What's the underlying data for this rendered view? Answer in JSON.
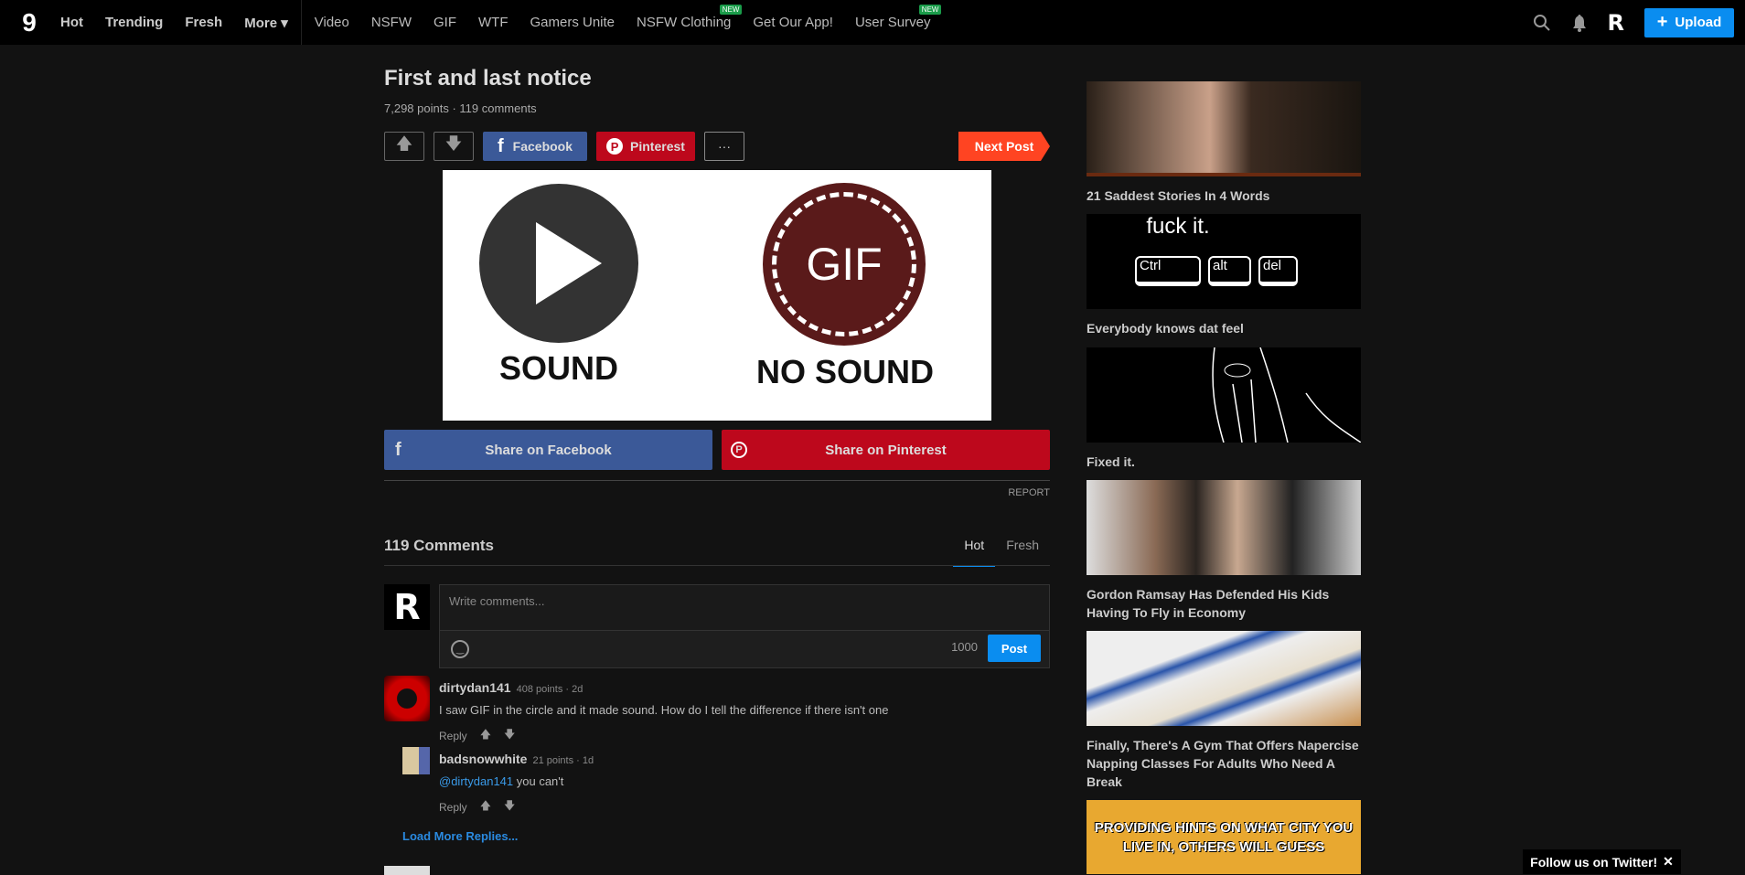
{
  "header": {
    "logo": "9",
    "nav": [
      {
        "label": "Hot",
        "bold": true
      },
      {
        "label": "Trending",
        "bold": true
      },
      {
        "label": "Fresh",
        "bold": true
      },
      {
        "label": "More ▾",
        "bold": true
      },
      {
        "label": "Video"
      },
      {
        "label": "NSFW"
      },
      {
        "label": "GIF"
      },
      {
        "label": "WTF"
      },
      {
        "label": "Gamers Unite"
      },
      {
        "label": "NSFW Clothing",
        "badge": "NEW"
      },
      {
        "label": "Get Our App!"
      },
      {
        "label": "User Survey",
        "badge": "NEW"
      }
    ],
    "avatar": "R",
    "upload_label": "Upload"
  },
  "post": {
    "title": "First and last notice",
    "meta": "7,298 points · 119 comments",
    "facebook": "Facebook",
    "pinterest": "Pinterest",
    "more": "···",
    "next": "Next Post",
    "image": {
      "left_label": "SOUND",
      "right_label": "NO SOUND",
      "gif": "GIF"
    },
    "share_fb": "Share on Facebook",
    "share_pin": "Share on Pinterest",
    "report": "REPORT"
  },
  "comments": {
    "heading": "119 Comments",
    "tabs": [
      "Hot",
      "Fresh"
    ],
    "placeholder": "Write comments...",
    "counter": "1000",
    "post_label": "Post",
    "user_avatar": "R",
    "reply": "Reply",
    "items": [
      {
        "user": "dirtydan141",
        "meta": "408 points · 2d",
        "text": "I saw GIF in the circle and it made sound. How do I tell the difference if there isn't one"
      },
      {
        "user": "badsnowwhite",
        "meta": "21 points · 1d",
        "mention": "@dirtydan141",
        "text": " you can't"
      }
    ],
    "load_more": "Load More Replies..."
  },
  "sidebar": [
    {
      "caption": "21 Saddest Stories In 4 Words"
    },
    {
      "caption": "Everybody knows dat feel",
      "img_text": "fuck it.",
      "keys": [
        "Ctrl",
        "alt",
        "del"
      ]
    },
    {
      "caption": "Fixed it."
    },
    {
      "caption": "Gordon Ramsay Has Defended His Kids Having To Fly in Economy"
    },
    {
      "caption": "Finally, There's A Gym That Offers Napercise Napping Classes For Adults Who Need A Break"
    },
    {
      "img_text": "PROVIDING HINTS ON WHAT CITY YOU LIVE IN, OTHERS WILL GUESS"
    }
  ],
  "twitter": {
    "label": "Follow us on Twitter!",
    "close": "✕"
  },
  "colors": {
    "accent": "#0a8df0",
    "facebook": "#3b5998",
    "pinterest": "#bd081c",
    "next": "#ff4422"
  }
}
